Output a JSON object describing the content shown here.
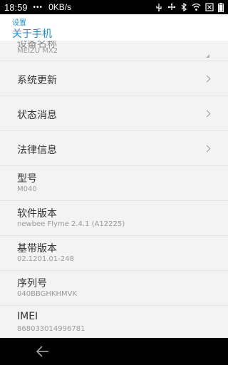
{
  "status": {
    "time": "18:59",
    "dots": "•••",
    "speed": "0KB/s"
  },
  "header": {
    "breadcrumb": "设置",
    "title": "关于手机"
  },
  "partial_item": {
    "label": "设备名称",
    "value": "MEIZU MX2"
  },
  "nav_items": [
    {
      "label": "系统更新"
    },
    {
      "label": "状态消息"
    },
    {
      "label": "法律信息"
    }
  ],
  "info_items": [
    {
      "label": "型号",
      "value": "M040"
    },
    {
      "label": "软件版本",
      "value": "newbee Flyme 2.4.1 (A12225)"
    },
    {
      "label": "基带版本",
      "value": "02.1201.01-248"
    },
    {
      "label": "序列号",
      "value": "040BBGHKHMVK"
    },
    {
      "label": "IMEI",
      "value": "868033014996781"
    }
  ],
  "colors": {
    "accent": "#1e8fd6",
    "background": "#f3f3f3",
    "statusbar": "#000000"
  }
}
